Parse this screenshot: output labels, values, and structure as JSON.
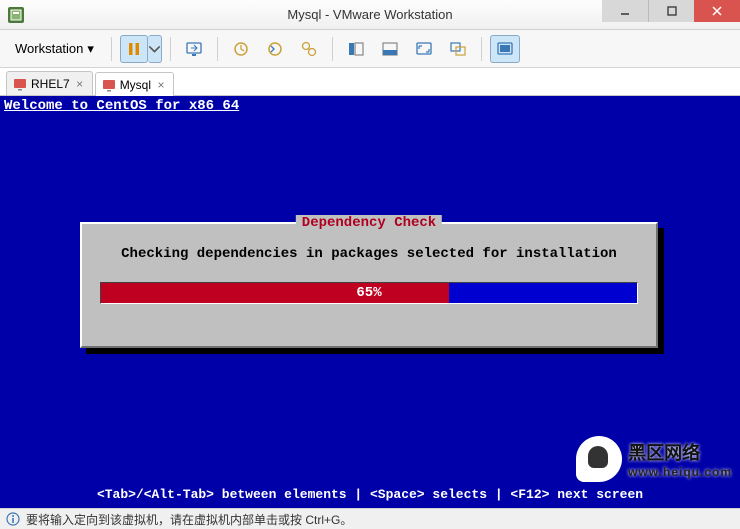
{
  "window": {
    "title": "Mysql - VMware Workstation"
  },
  "toolbar": {
    "menu_label": "Workstation"
  },
  "tabs": [
    {
      "label": "RHEL7",
      "active": false
    },
    {
      "label": "Mysql",
      "active": true
    }
  ],
  "vm": {
    "welcome": "Welcome to CentOS for x86_64",
    "dialog_title": "Dependency Check",
    "dialog_message": "Checking dependencies in packages selected for installation",
    "progress_percent": 65,
    "progress_label": "65%",
    "help_text": "<Tab>/<Alt-Tab> between elements   |   <Space> selects   |   <F12> next screen"
  },
  "statusbar": {
    "text": "要将输入定向到该虚拟机，请在虚拟机内部单击或按 Ctrl+G。"
  },
  "watermark": {
    "line1": "黑区网络",
    "line2": "www.heiqu.com"
  }
}
